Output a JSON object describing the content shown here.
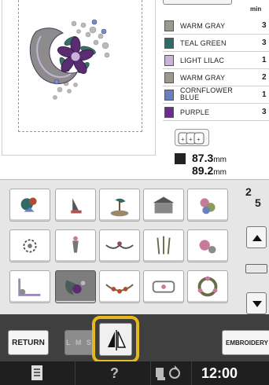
{
  "threads": {
    "header_label": "min",
    "rows": [
      {
        "name": "WARM GRAY",
        "minutes": "3",
        "color": "#9c9a8e"
      },
      {
        "name": "TEAL GREEN",
        "minutes": "3",
        "color": "#2f6c66"
      },
      {
        "name": "LIGHT LILAC",
        "minutes": "1",
        "color": "#c9b3d8"
      },
      {
        "name": "WARM GRAY",
        "minutes": "2",
        "color": "#9c9a8e"
      },
      {
        "name_line1": "CORNFLOWER",
        "name_line2": "BLUE",
        "minutes": "1",
        "color": "#6b7fbf"
      },
      {
        "name": "PURPLE",
        "minutes": "3",
        "color": "#6a2f8a"
      }
    ]
  },
  "size": {
    "width": "87.3",
    "height": "89.2",
    "unit": "mm"
  },
  "pagination": {
    "current": "2",
    "total": "5"
  },
  "buttons": {
    "return": "RETURN",
    "lms": "L M S",
    "embroidery": "EMBROIDERY"
  },
  "status": {
    "clock": "12:00",
    "help": "?"
  },
  "colors": {
    "highlight": "#e5b81b",
    "dark_bar": "#3f3f3f",
    "status_bar": "#1f1f1f"
  }
}
